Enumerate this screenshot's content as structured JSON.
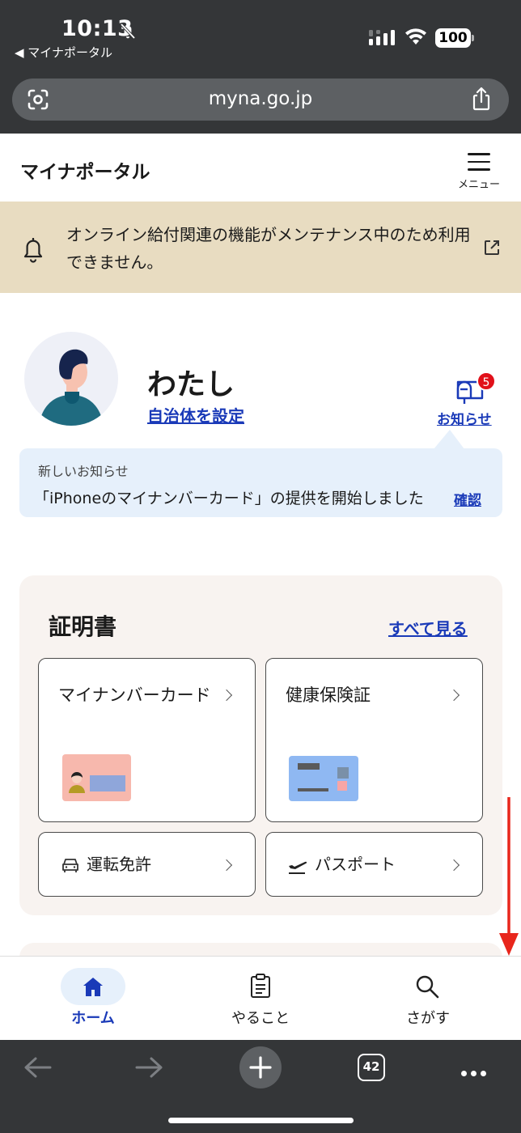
{
  "status_bar": {
    "time": "10:13",
    "back_app": "◀ マイナポータル",
    "battery": "100"
  },
  "browser": {
    "url": "myna.go.jp",
    "tab_count": "42"
  },
  "header": {
    "site_title": "マイナポータル",
    "menu_label": "メニュー"
  },
  "banner": {
    "text": "オンライン給付関連の機能がメンテナンス中のため利用できません。"
  },
  "profile": {
    "name": "わたし",
    "municipality_link": "自治体を設定",
    "notice_link": "お知らせ",
    "badge_count": "5"
  },
  "news": {
    "label": "新しいお知らせ",
    "text": "「iPhoneのマイナンバーカード」の提供を開始しました",
    "confirm": "確認"
  },
  "certificates": {
    "title": "証明書",
    "see_all": "すべて見る",
    "cards": [
      {
        "label": "マイナンバーカード"
      },
      {
        "label": "健康保険証"
      },
      {
        "label": "運転免許"
      },
      {
        "label": "パスポート"
      }
    ]
  },
  "tabbar": {
    "tabs": [
      {
        "label": "ホーム",
        "active": true
      },
      {
        "label": "やること",
        "active": false
      },
      {
        "label": "さがす",
        "active": false
      }
    ]
  },
  "colors": {
    "accent": "#1a3ab8",
    "banner_bg": "#e8dcc1",
    "news_bg": "#e6f0fb",
    "badge": "#e1101a"
  }
}
